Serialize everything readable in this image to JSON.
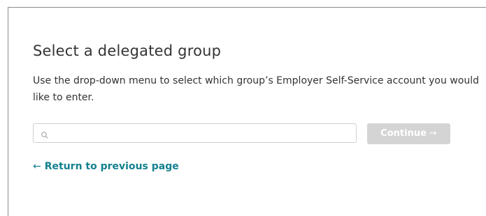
{
  "page": {
    "title": "Select a delegated group",
    "description": "Use the drop-down menu to select which group’s Employer Self-Service account you would like to enter."
  },
  "search": {
    "placeholder": "",
    "value": "",
    "icon": "search-icon"
  },
  "continue_button": {
    "label": "Continue",
    "arrow": "→",
    "state": "disabled",
    "background_color": "#d4d4d4",
    "text_color": "#ffffff"
  },
  "back_link": {
    "arrow": "←",
    "label": "Return to previous page",
    "color": "#14808f"
  }
}
